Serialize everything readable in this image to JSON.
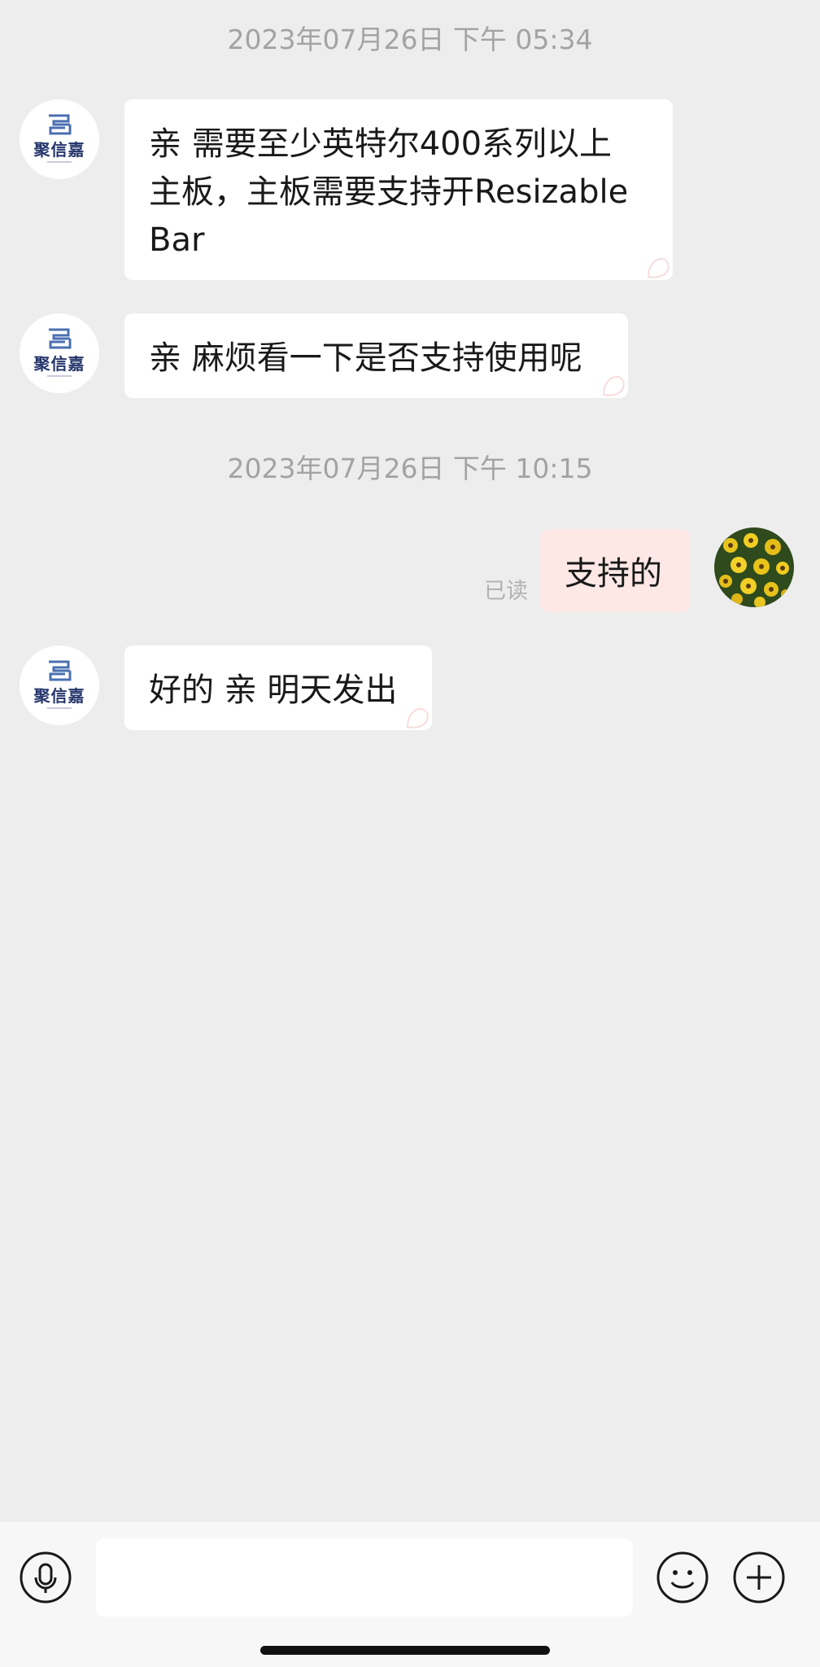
{
  "messages_section": {
    "timestamp_1": "2023年07月26日 下午 05:34",
    "timestamp_2": "2023年07月26日 下午 10:15"
  },
  "seller": {
    "logo_text": "聚信嘉",
    "brand_color": "#25356b"
  },
  "messages": [
    {
      "from": "seller",
      "text": "亲 需要至少英特尔400系列以上\n主板，主板需要支持开Resizable\nBar"
    },
    {
      "from": "seller",
      "text": "亲 麻烦看一下是否支持使用呢"
    },
    {
      "from": "me",
      "text": "支持的",
      "status": "已读"
    },
    {
      "from": "seller",
      "text": "好的 亲 明天发出"
    }
  ],
  "input_bar": {
    "voice_icon": "microphone-icon",
    "emoji_icon": "smiley-icon",
    "more_icon": "plus-circle-icon",
    "input_value": ""
  },
  "colors": {
    "background": "#ededed",
    "incoming_bubble": "#ffffff",
    "outgoing_bubble": "#fde8e6",
    "timestamp": "#a3a3a3"
  }
}
